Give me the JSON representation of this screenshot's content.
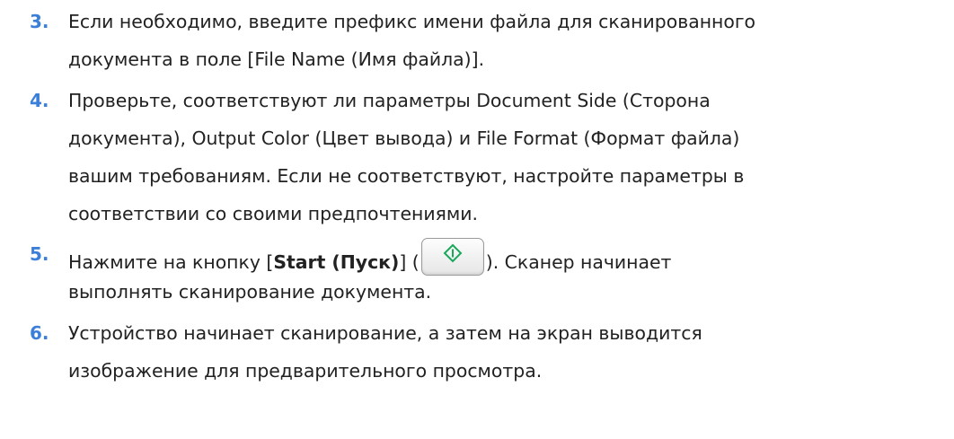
{
  "steps": [
    {
      "number": "3.",
      "lines": [
        "Если необходимо, введите префикс имени файла для сканированного",
        "документа в поле [File Name (Имя файла)]."
      ]
    },
    {
      "number": "4.",
      "lines": [
        "Проверьте, соответствуют ли параметры Document Side (Сторона",
        "документа), Output Color (Цвет вывода) и File Format (Формат файла)",
        "вашим требованиям. Если не соответствуют, настройте параметры в",
        "соответствии со своими предпочтениями."
      ]
    },
    {
      "number": "5.",
      "line1_before": "Нажмите на кнопку [",
      "line1_bold": "Start (Пуск)",
      "line1_after_bracket": "] (",
      "line1_after_button": "). Сканер начинает",
      "line2": "выполнять сканирование документа.",
      "start_icon": "start-diamond-icon",
      "start_icon_color": "#19a85a"
    },
    {
      "number": "6.",
      "lines": [
        "Устройство начинает сканирование, а затем на экран выводится",
        "изображение для предварительного просмотра."
      ]
    }
  ],
  "colors": {
    "step_number": "#3b7fd8",
    "text": "#222222"
  }
}
